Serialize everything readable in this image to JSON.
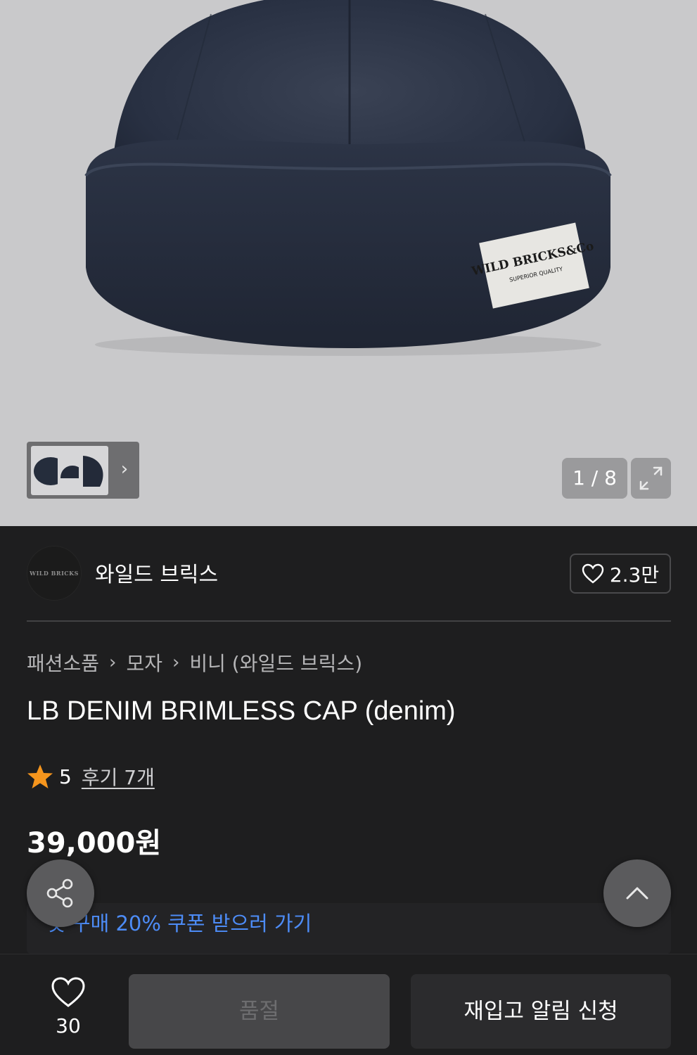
{
  "gallery": {
    "counter": "1 / 8",
    "thumbnail_arrow": "›",
    "label_lines": [
      "WILD BRICKS&Co",
      "SUPERIOR QUALITY"
    ]
  },
  "brand": {
    "logo_text": "WILD BRICKS",
    "name": "와일드 브릭스",
    "like_count": "2.3만"
  },
  "breadcrumb": {
    "items": [
      "패션소품",
      "모자",
      "비니 (와일드 브릭스)"
    ],
    "separator": "›"
  },
  "product": {
    "title": "LB DENIM BRIMLESS CAP (denim)",
    "rating": "5",
    "reviews": "후기 7개",
    "price": "39,000원"
  },
  "coupon": {
    "text": "첫 구매 20% 쿠폰 받으러 가기",
    "arrow": "›"
  },
  "bottom_bar": {
    "wish_count": "30",
    "soldout_label": "품절",
    "restock_label": "재입고 알림 신청"
  },
  "colors": {
    "background": "#1e1e1f",
    "coupon_blue": "#4d8cf7",
    "star": "#f5951d",
    "soldout_bg": "#474749"
  },
  "icons": [
    "share-icon",
    "chevron-up-icon",
    "heart-icon",
    "star-icon",
    "expand-icon"
  ]
}
